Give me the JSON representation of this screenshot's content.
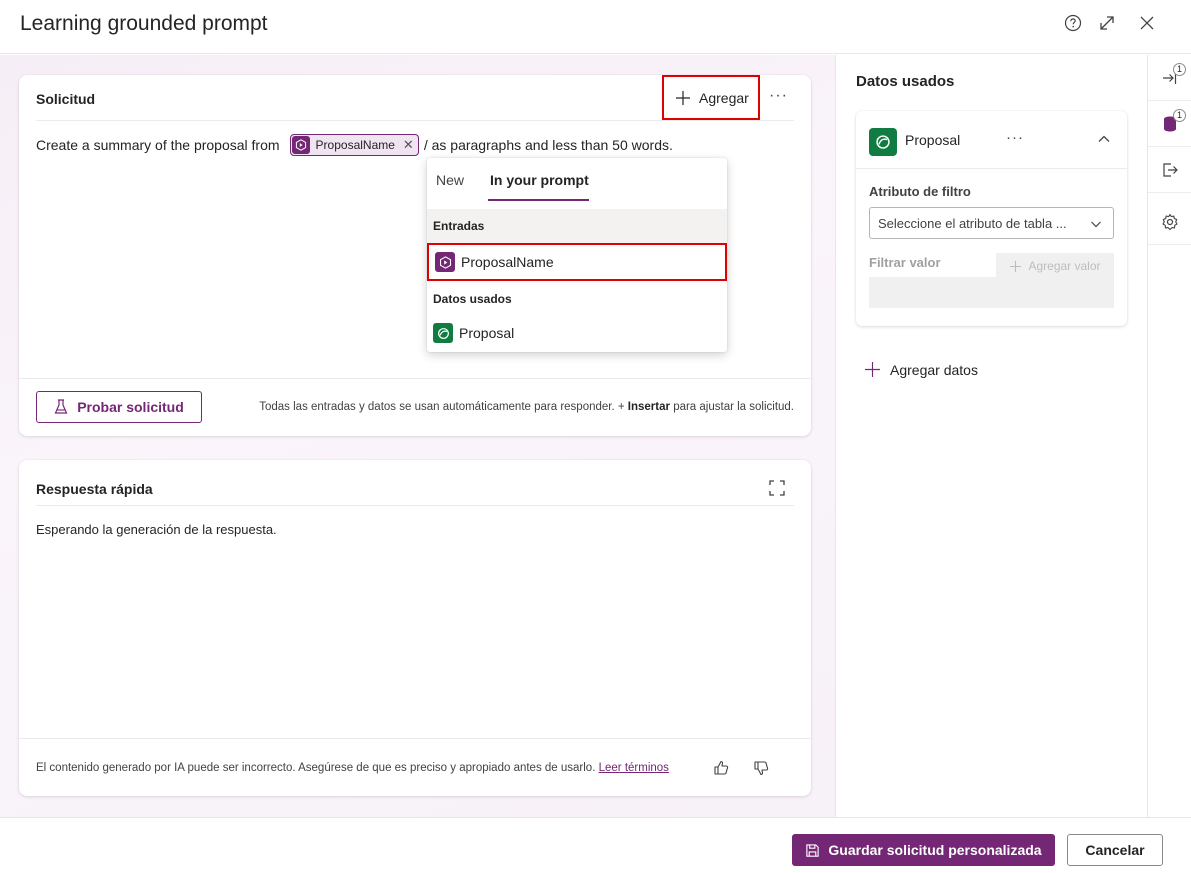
{
  "header": {
    "title": "Learning grounded prompt",
    "icons": [
      "help-icon",
      "expand-icon",
      "close-icon"
    ]
  },
  "prompt_card": {
    "title": "Solicitud",
    "add_label": "Agregar",
    "more_label": "···",
    "prompt_before": "Create a summary of the proposal from",
    "chip_label": "ProposalName",
    "chip_remove": "✕",
    "prompt_after": "/ as paragraphs and less than 50 words.",
    "test_label": "Probar solicitud",
    "hint_prefix": "Todas las entradas y datos se usan automáticamente para responder. +",
    "hint_bold": "Insertar",
    "hint_suffix": "para ajustar la solicitud."
  },
  "insert_dropdown": {
    "tabs": [
      {
        "label": "New",
        "active": false
      },
      {
        "label": "In your prompt",
        "active": true
      }
    ],
    "sections": [
      {
        "title": "Entradas",
        "items": [
          {
            "label": "ProposalName",
            "icon": "prompt-input-icon"
          }
        ]
      },
      {
        "title": "Datos usados",
        "items": [
          {
            "label": "Proposal",
            "icon": "dataverse-table-icon"
          }
        ]
      }
    ]
  },
  "response_card": {
    "title": "Respuesta rápida",
    "status": "Esperando la generación de la respuesta.",
    "disclaimer": "El contenido generado por IA puede ser incorrecto. Asegúrese de que es preciso y apropiado antes de usarlo.",
    "terms_link": "Leer términos"
  },
  "data_panel": {
    "title": "Datos usados",
    "table_name": "Proposal",
    "more_label": "···",
    "filter_attribute_label": "Atributo de filtro",
    "filter_attribute_placeholder": "Seleccione el atributo de tabla ...",
    "filter_value_label": "Filtrar valor",
    "add_value_label": "Agregar valor",
    "add_data_label": "Agregar datos"
  },
  "rail": {
    "items": [
      {
        "icon": "inputs-icon",
        "badge": "1"
      },
      {
        "icon": "data-icon",
        "badge": "1"
      },
      {
        "icon": "output-icon",
        "badge": ""
      },
      {
        "icon": "settings-icon",
        "badge": ""
      }
    ]
  },
  "footer": {
    "save_label": "Guardar solicitud personalizada",
    "cancel_label": "Cancelar"
  },
  "colors": {
    "brand": "#742774",
    "data_green": "#107c41",
    "highlight_red": "#e00000"
  }
}
